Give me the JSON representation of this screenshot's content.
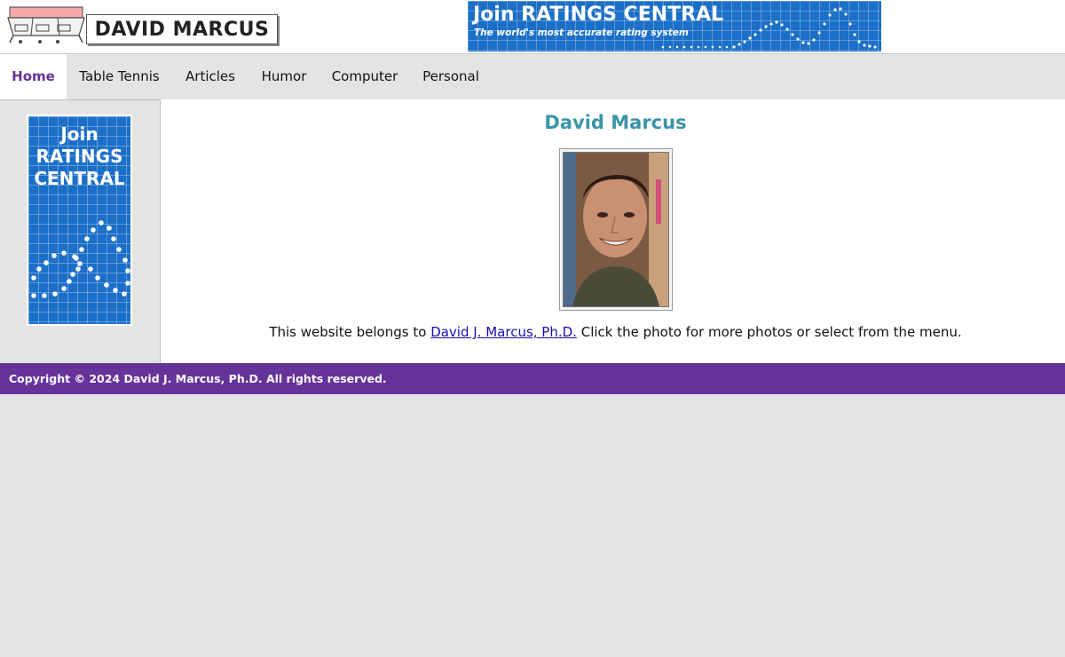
{
  "header": {
    "site_name": "DAVID MARCUS",
    "banner": {
      "title": "Join RATINGS CENTRAL",
      "tagline": "The world's most accurate rating system"
    }
  },
  "nav": {
    "items": [
      {
        "label": "Home",
        "active": true
      },
      {
        "label": "Table Tennis",
        "active": false
      },
      {
        "label": "Articles",
        "active": false
      },
      {
        "label": "Humor",
        "active": false
      },
      {
        "label": "Computer",
        "active": false
      },
      {
        "label": "Personal",
        "active": false
      }
    ]
  },
  "sidebar": {
    "banner_lines": [
      "Join",
      "RATINGS",
      "CENTRAL"
    ]
  },
  "main": {
    "title": "David Marcus",
    "photo_icon": "portrait-photo",
    "text_before": "This website belongs to ",
    "link_text": "David J. Marcus, Ph.D.",
    "text_after": " Click the photo for more photos or select from the menu."
  },
  "footer": {
    "copyright": "Copyright © 2024 David J. Marcus, Ph.D. All rights reserved."
  },
  "colors": {
    "accent": "#663399",
    "title": "#3a95a8",
    "banner_blue": "#1b6fc7",
    "link": "#1a0dab"
  }
}
